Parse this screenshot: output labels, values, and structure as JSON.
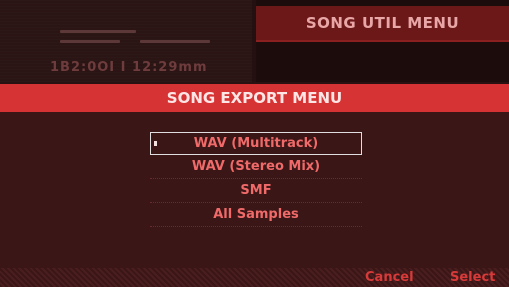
{
  "header": {
    "util_menu_title": "SONG UTIL MENU",
    "dim_text": "1B2:0OI I 12:29mm"
  },
  "export_menu": {
    "title": "SONG EXPORT MENU",
    "items": [
      {
        "label": "WAV (Multitrack)",
        "selected": true
      },
      {
        "label": "WAV (Stereo Mix)",
        "selected": false
      },
      {
        "label": "SMF",
        "selected": false
      },
      {
        "label": "All Samples",
        "selected": false
      }
    ]
  },
  "footer": {
    "cancel_label": "Cancel",
    "select_label": "Select"
  },
  "colors": {
    "accent_red": "#d63434",
    "menu_text": "#f06a6a",
    "background": "#2a1212"
  }
}
